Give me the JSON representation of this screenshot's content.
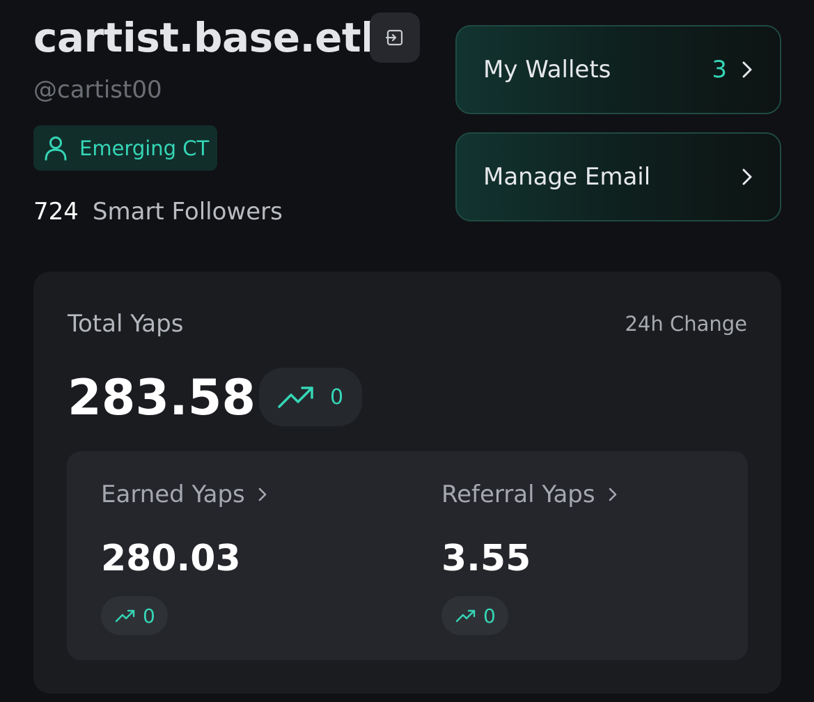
{
  "profile": {
    "display_name": "cartist.base.eth",
    "handle": "@cartist00",
    "tier_badge": "Emerging CT",
    "smart_followers_count": "724",
    "smart_followers_label": "Smart Followers",
    "logout_icon": "logout-icon",
    "tier_icon": "user-icon"
  },
  "actions": {
    "wallets_label": "My Wallets",
    "wallets_count": "3",
    "email_label": "Manage Email",
    "chevron_icon": "chevron-right-icon"
  },
  "yaps": {
    "total_label": "Total Yaps",
    "change_label": "24h Change",
    "total_value": "283.58",
    "total_change": "0",
    "earned_label": "Earned Yaps",
    "earned_value": "280.03",
    "earned_change": "0",
    "referral_label": "Referral Yaps",
    "referral_value": "3.55",
    "referral_change": "0",
    "trend_icon": "trending-up-icon"
  },
  "colors": {
    "accent": "#35d6b6",
    "background": "#101114",
    "panel": "#1a1c20",
    "sub_panel": "#24262b",
    "card_border": "#1f4a42"
  }
}
